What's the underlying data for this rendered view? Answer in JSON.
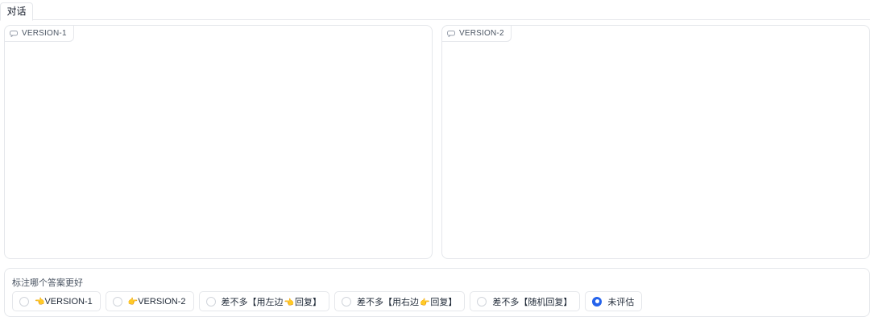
{
  "tabs": [
    {
      "label": "对话"
    }
  ],
  "panels": [
    {
      "label": "VERSION-1",
      "icon": "chat-icon"
    },
    {
      "label": "VERSION-2",
      "icon": "chat-icon"
    }
  ],
  "rating": {
    "label": "标注哪个答案更好",
    "options": [
      {
        "label": "VERSION-1",
        "icon": "hand-left-icon",
        "selected": false
      },
      {
        "label": "VERSION-2",
        "icon": "hand-right-icon",
        "selected": false
      },
      {
        "label_before": "差不多【用左边",
        "label_after": "回复】",
        "icon": "hand-left-icon",
        "selected": false
      },
      {
        "label_before": "差不多【用右边",
        "label_after": "回复】",
        "icon": "hand-right-icon",
        "selected": false
      },
      {
        "label": "差不多【随机回复】",
        "selected": false
      },
      {
        "label": "未评估",
        "selected": true
      }
    ]
  },
  "colors": {
    "accent": "#2563eb",
    "border": "#e5e7eb"
  }
}
